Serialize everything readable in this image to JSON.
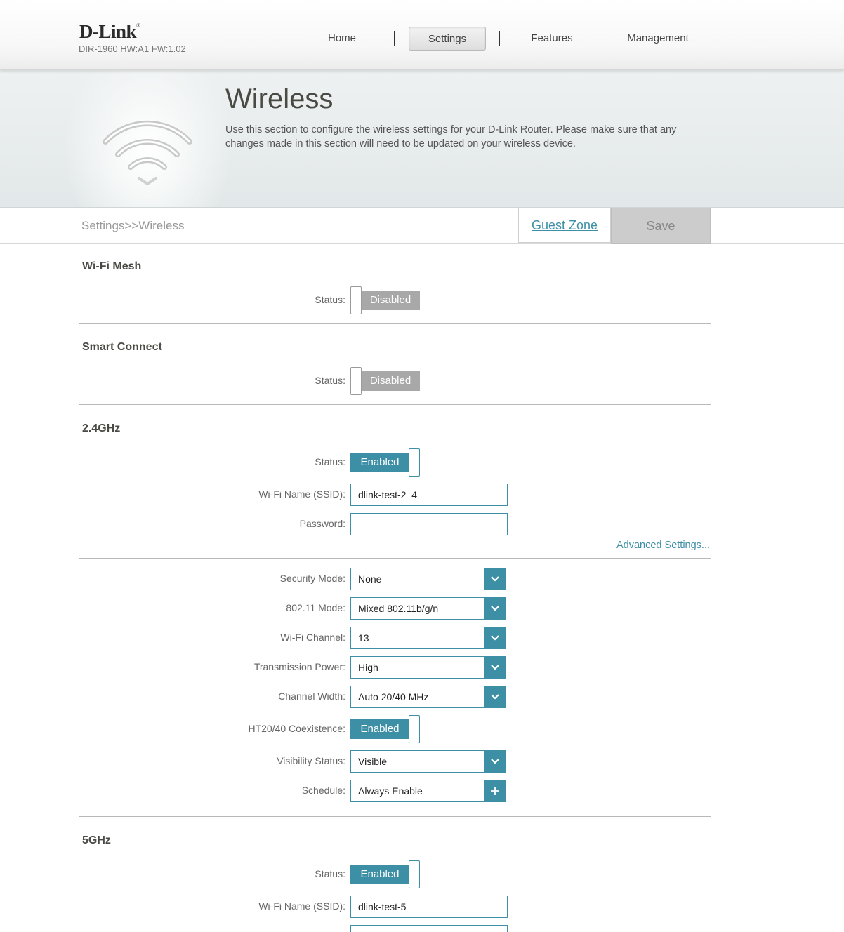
{
  "header": {
    "logo": "D-Link",
    "logo_mark": "®",
    "model": "DIR-1960 HW:A1 FW:1.02",
    "nav": [
      {
        "label": "Home"
      },
      {
        "label": "Settings"
      },
      {
        "label": "Features"
      },
      {
        "label": "Management"
      }
    ]
  },
  "banner": {
    "title": "Wireless",
    "description": "Use this section to configure the wireless settings for your D-Link Router. Please make sure that any changes made in this section will need to be updated on your wireless device.",
    "icon": "wifi-icon"
  },
  "breadcrumb": "Settings>>Wireless",
  "actions": {
    "guest_zone": "Guest Zone",
    "save": "Save"
  },
  "colors": {
    "accent": "#3d8fa6",
    "disabled": "#a8a8a8"
  },
  "wifi_mesh": {
    "title": "Wi-Fi Mesh",
    "status_label": "Status:",
    "status": "Disabled"
  },
  "smart_connect": {
    "title": "Smart Connect",
    "status_label": "Status:",
    "status": "Disabled"
  },
  "band24": {
    "title": "2.4GHz",
    "status_label": "Status:",
    "status": "Enabled",
    "ssid_label": "Wi-Fi Name (SSID):",
    "ssid": "dlink-test-2_4",
    "password_label": "Password:",
    "password": "",
    "advanced_link": "Advanced Settings...",
    "security_mode_label": "Security Mode:",
    "security_mode": "None",
    "mode_label": "802.11 Mode:",
    "mode": "Mixed 802.11b/g/n",
    "channel_label": "Wi-Fi Channel:",
    "channel": "13",
    "power_label": "Transmission Power:",
    "power": "High",
    "width_label": "Channel Width:",
    "width": "Auto 20/40 MHz",
    "coexistence_label": "HT20/40 Coexistence:",
    "coexistence": "Enabled",
    "visibility_label": "Visibility Status:",
    "visibility": "Visible",
    "schedule_label": "Schedule:",
    "schedule": "Always Enable"
  },
  "band5": {
    "title": "5GHz",
    "status_label": "Status:",
    "status": "Enabled",
    "ssid_label": "Wi-Fi Name (SSID):",
    "ssid": "dlink-test-5"
  }
}
